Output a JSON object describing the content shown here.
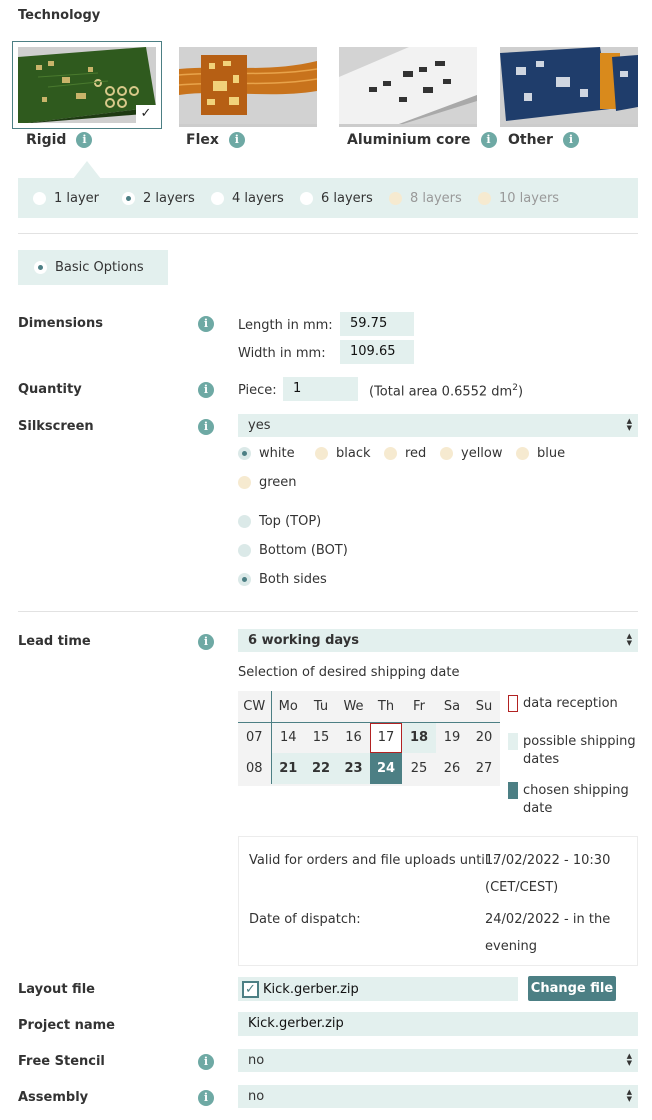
{
  "section_title": "Technology",
  "technologies": [
    {
      "label": "Rigid",
      "selected": true
    },
    {
      "label": "Flex",
      "selected": false
    },
    {
      "label": "Aluminium core",
      "selected": false
    },
    {
      "label": "Other",
      "selected": false
    }
  ],
  "layers": [
    {
      "label": "1 layer",
      "state": "off"
    },
    {
      "label": "2 layers",
      "state": "on"
    },
    {
      "label": "4 layers",
      "state": "off"
    },
    {
      "label": "6 layers",
      "state": "off"
    },
    {
      "label": "8 layers",
      "state": "disabled"
    },
    {
      "label": "10 layers",
      "state": "disabled"
    }
  ],
  "basic_options": "Basic Options",
  "dimensions": {
    "label": "Dimensions",
    "length_label": "Length in mm:",
    "length_value": "59.75",
    "width_label": "Width in mm:",
    "width_value": "109.65"
  },
  "quantity": {
    "label": "Quantity",
    "piece_label": "Piece:",
    "piece_value": "1",
    "total_area": "(Total area 0.6552 dm",
    "total_area_sup": "2",
    "total_area_end": ")"
  },
  "silkscreen": {
    "label": "Silkscreen",
    "select_value": "yes",
    "colors": [
      "white",
      "black",
      "red",
      "yellow",
      "blue",
      "green"
    ],
    "sides": [
      "Top (TOP)",
      "Bottom (BOT)",
      "Both sides"
    ]
  },
  "lead_time": {
    "label": "Lead time",
    "select_value": "6 working days",
    "shipping_title": "Selection of desired shipping date",
    "calendar_headers": [
      "CW",
      "Mo",
      "Tu",
      "We",
      "Th",
      "Fr",
      "Sa",
      "Su"
    ],
    "calendar_rows": [
      [
        "07",
        "14",
        "15",
        "16",
        "17",
        "18",
        "19",
        "20"
      ],
      [
        "08",
        "21",
        "22",
        "23",
        "24",
        "25",
        "26",
        "27"
      ]
    ],
    "legend": {
      "data_reception": "data reception",
      "possible_line1": "possible shipping",
      "possible_line2": "dates",
      "chosen_line1": "chosen shipping",
      "chosen_line2": "date"
    },
    "valid_label": "Valid for orders and file uploads until :",
    "valid_value_1": "17/02/2022 - 10:30",
    "valid_value_2": "(CET/CEST)",
    "dispatch_label": "Date of dispatch:",
    "dispatch_value_1": "24/02/2022 - in the",
    "dispatch_value_2": "evening"
  },
  "layout_file": {
    "label": "Layout file",
    "file_name": "Kick.gerber.zip",
    "change_button": "Change file"
  },
  "project_name": {
    "label": "Project name",
    "value": "Kick.gerber.zip"
  },
  "free_stencil": {
    "label": "Free Stencil",
    "select_value": "no"
  },
  "assembly": {
    "label": "Assembly",
    "select_value": "no"
  },
  "colors": {
    "accent": "#4c7f84",
    "light": "#e3f0ee",
    "info": "#6ea9a4",
    "reception": "#b22222"
  }
}
